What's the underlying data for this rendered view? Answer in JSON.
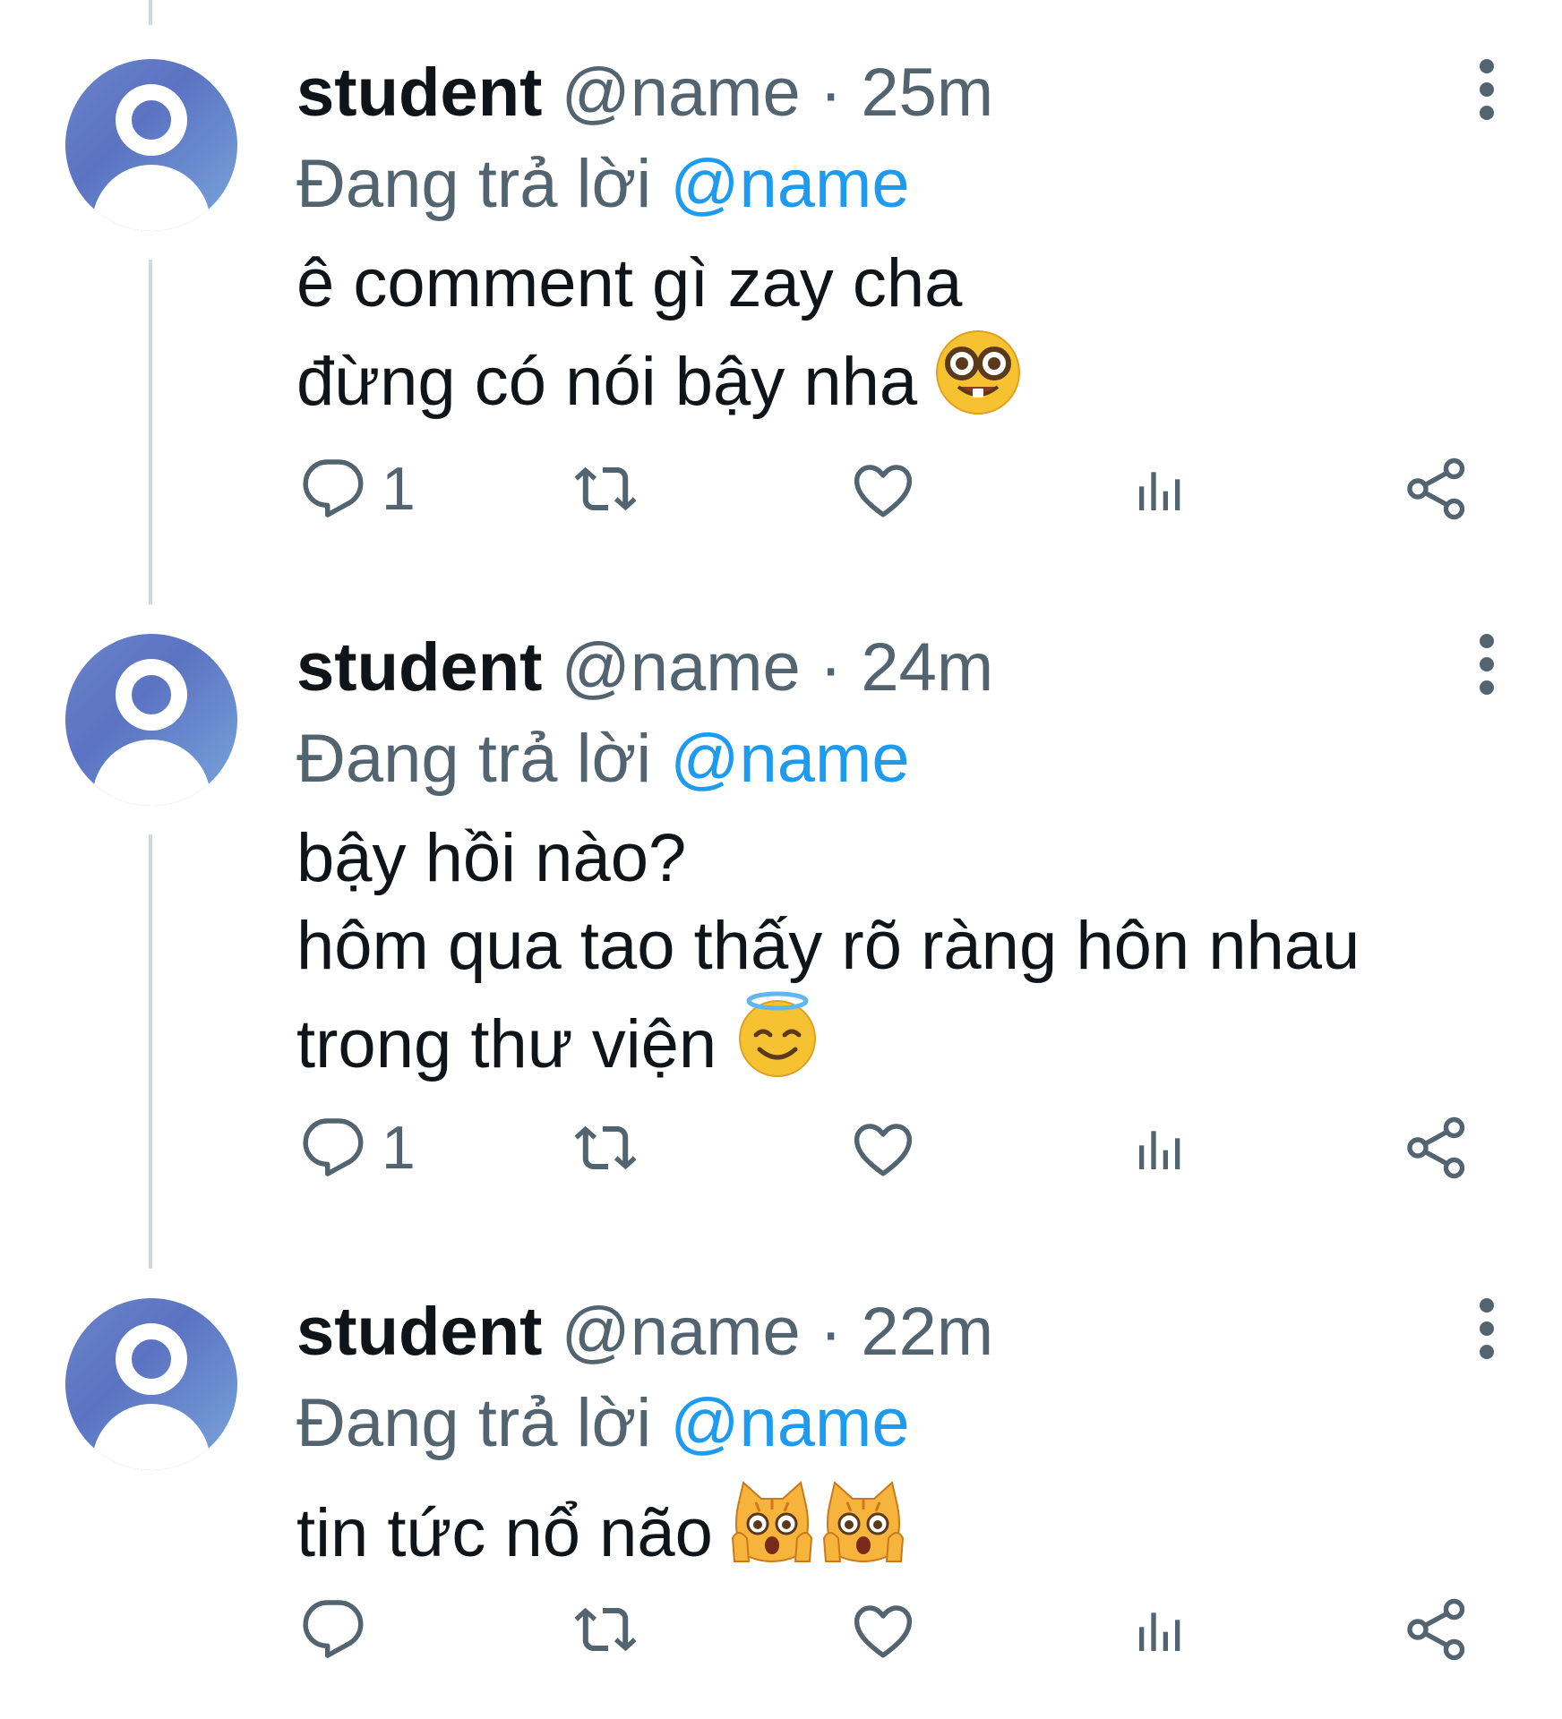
{
  "tweets": [
    {
      "name": "student",
      "handle": "@name",
      "dot": "·",
      "time": "25m",
      "replying_prefix": "Đang trả lời",
      "replying_to": "@name",
      "lines": [
        "ê comment gì zay cha",
        "đừng có nói bậy nha"
      ],
      "emoji_names": [
        "nerd-face-emoji"
      ],
      "reply_count": "1"
    },
    {
      "name": "student",
      "handle": "@name",
      "dot": "·",
      "time": "24m",
      "replying_prefix": "Đang trả lời",
      "replying_to": "@name",
      "lines": [
        "bậy hồi nào?",
        "hôm qua tao thấy rõ ràng hôn nhau",
        "trong thư viện"
      ],
      "emoji_names": [
        "smiling-face-with-halo-emoji"
      ],
      "reply_count": "1"
    },
    {
      "name": "student",
      "handle": "@name",
      "dot": "·",
      "time": "22m",
      "replying_prefix": "Đang trả lời",
      "replying_to": "@name",
      "lines": [
        "tin tức nổ não"
      ],
      "emoji_names": [
        "weary-cat-emoji",
        "weary-cat-emoji"
      ],
      "reply_count": ""
    }
  ],
  "action_icons": [
    "reply-icon",
    "retweet-icon",
    "like-icon",
    "views-icon",
    "share-icon"
  ],
  "colors": {
    "accent": "#1d9bf0",
    "muted": "#536471",
    "text": "#0f1419",
    "thread_line": "#cfd9de"
  }
}
